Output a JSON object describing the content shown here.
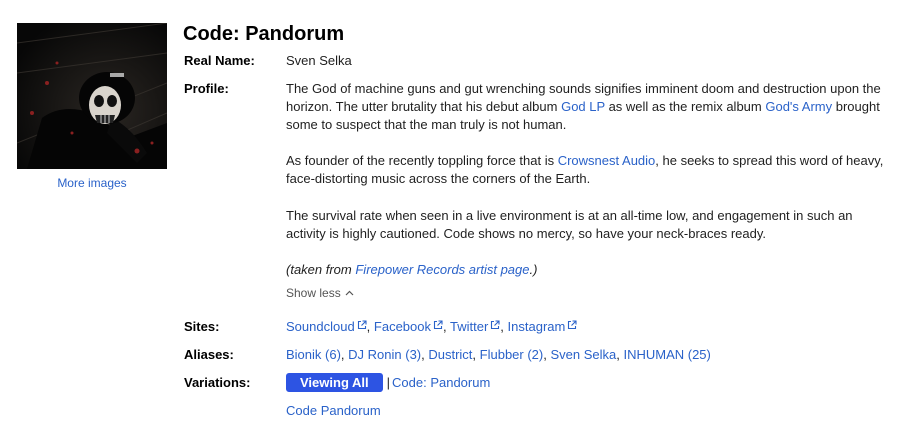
{
  "artist": {
    "name": "Code: Pandorum",
    "more_images": "More images"
  },
  "fields": {
    "real_name_label": "Real Name:",
    "real_name": "Sven Selka",
    "profile_label": "Profile:",
    "sites_label": "Sites:",
    "aliases_label": "Aliases:",
    "variations_label": "Variations:"
  },
  "profile": {
    "p1_a": "The God of machine guns and gut wrenching sounds signifies imminent doom and destruction upon the horizon. The utter brutality that his debut album ",
    "p1_link1": "God LP",
    "p1_b": " as well as the remix album ",
    "p1_link2": "God's Army",
    "p1_c": " brought some to suspect that the man truly is not human.",
    "p2_a": "As founder of the recently toppling force that is ",
    "p2_link": "Crowsnest Audio",
    "p2_b": ", he seeks to spread this word of heavy, face-distorting music across the corners of the Earth.",
    "p3": "The survival rate when seen in a live environment is at an all-time low, and engagement in such an activity is highly cautioned. Code shows no mercy, so have your neck-braces ready.",
    "p4_a": "(taken from ",
    "p4_link": "Firepower Records artist page",
    "p4_b": ".)",
    "show_less": "Show less"
  },
  "sites": [
    {
      "label": "Soundcloud"
    },
    {
      "label": "Facebook"
    },
    {
      "label": "Twitter"
    },
    {
      "label": "Instagram"
    }
  ],
  "aliases": {
    "a1": "Bionik (6)",
    "a2": "DJ Ronin (3)",
    "a3": "Dustrict",
    "a4": "Flubber (2)",
    "a5": "Sven Selka",
    "a6": "INHUMAN (25)"
  },
  "variations": {
    "button": "Viewing All",
    "current": "Code: Pandorum",
    "other": "Code Pandorum"
  },
  "colors": {
    "link": "#2a62c9",
    "button": "#2d54e3"
  }
}
